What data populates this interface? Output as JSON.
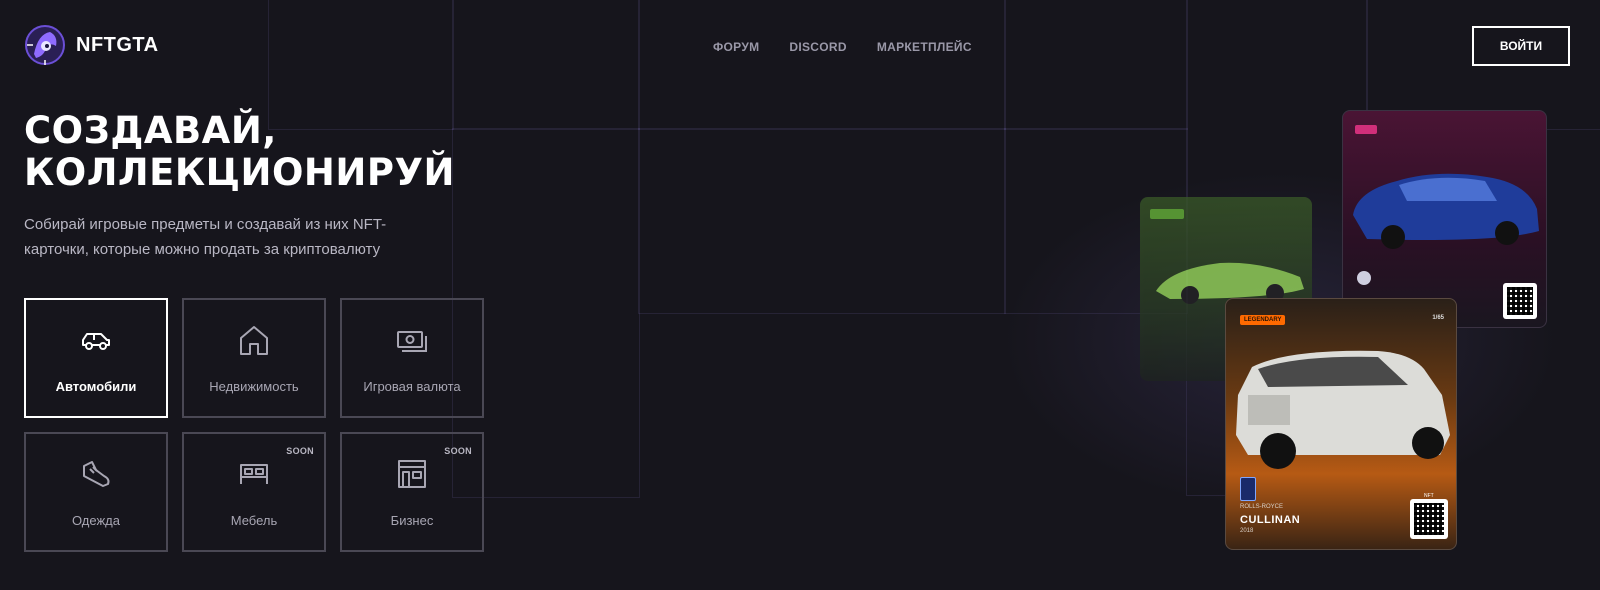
{
  "brand": {
    "name": "NFTGTA"
  },
  "nav": {
    "items": [
      "ФОРУМ",
      "DISCORD",
      "МАРКЕТПЛЕЙС"
    ]
  },
  "header": {
    "login_label": "ВОЙТИ"
  },
  "hero": {
    "title_line1": "СОЗДАВАЙ,",
    "title_line2": "КОЛЛЕКЦИОНИРУЙ",
    "subtitle": "Собирай игровые предметы и создавай из них NFT-карточки, которые можно продать за криптовалюту"
  },
  "categories": [
    {
      "label": "Автомобили",
      "icon": "car-icon",
      "active": true
    },
    {
      "label": "Недвижимость",
      "icon": "house-icon"
    },
    {
      "label": "Игровая валюта",
      "icon": "money-icon"
    },
    {
      "label": "Одежда",
      "icon": "shoe-icon"
    },
    {
      "label": "Мебель",
      "icon": "bed-icon",
      "badge": "SOON"
    },
    {
      "label": "Бизнес",
      "icon": "store-icon",
      "badge": "SOON"
    }
  ],
  "cards": {
    "orange": {
      "rarity": "LEGENDARY",
      "count": "1/65",
      "brand": "ROLLS-ROYCE",
      "model": "CULLINAN",
      "year": "2018",
      "nft": "NFT"
    }
  },
  "colors": {
    "background": "#16151c",
    "accent_orange": "#ff6a00",
    "accent_pink": "#d02f7a",
    "accent_green": "#6bbd3a"
  }
}
